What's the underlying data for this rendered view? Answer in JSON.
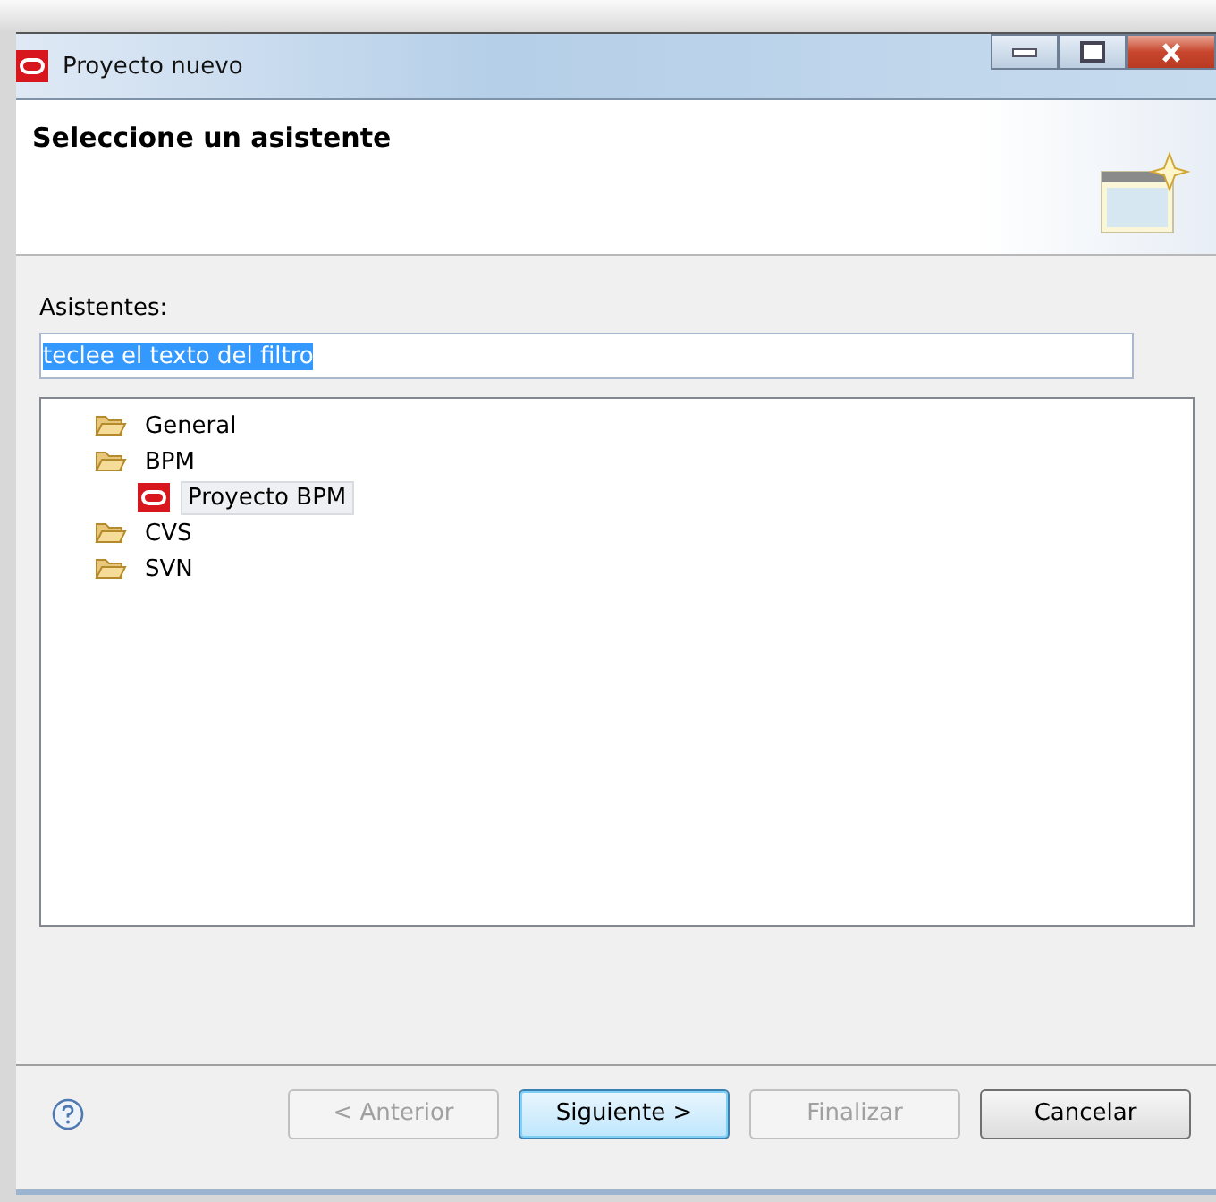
{
  "window": {
    "title": "Proyecto nuevo"
  },
  "header": {
    "title": "Seleccione un asistente"
  },
  "wizards": {
    "label": "Asistentes:",
    "filter": {
      "value": "teclee el texto del filtro",
      "text_selected": true
    },
    "tree": [
      {
        "label": "General",
        "kind": "folder",
        "selected": false
      },
      {
        "label": "BPM",
        "kind": "folder",
        "selected": false,
        "children": [
          {
            "label": "Proyecto BPM",
            "kind": "project",
            "selected": true
          }
        ]
      },
      {
        "label": "CVS",
        "kind": "folder",
        "selected": false
      },
      {
        "label": "SVN",
        "kind": "folder",
        "selected": false
      }
    ]
  },
  "buttons": [
    {
      "label": "< Anterior",
      "disabled": true,
      "default": false
    },
    {
      "label": "Siguiente >",
      "disabled": false,
      "default": true
    },
    {
      "label": "Finalizar",
      "disabled": true,
      "default": false
    },
    {
      "label": "Cancelar",
      "disabled": false,
      "default": false
    }
  ]
}
